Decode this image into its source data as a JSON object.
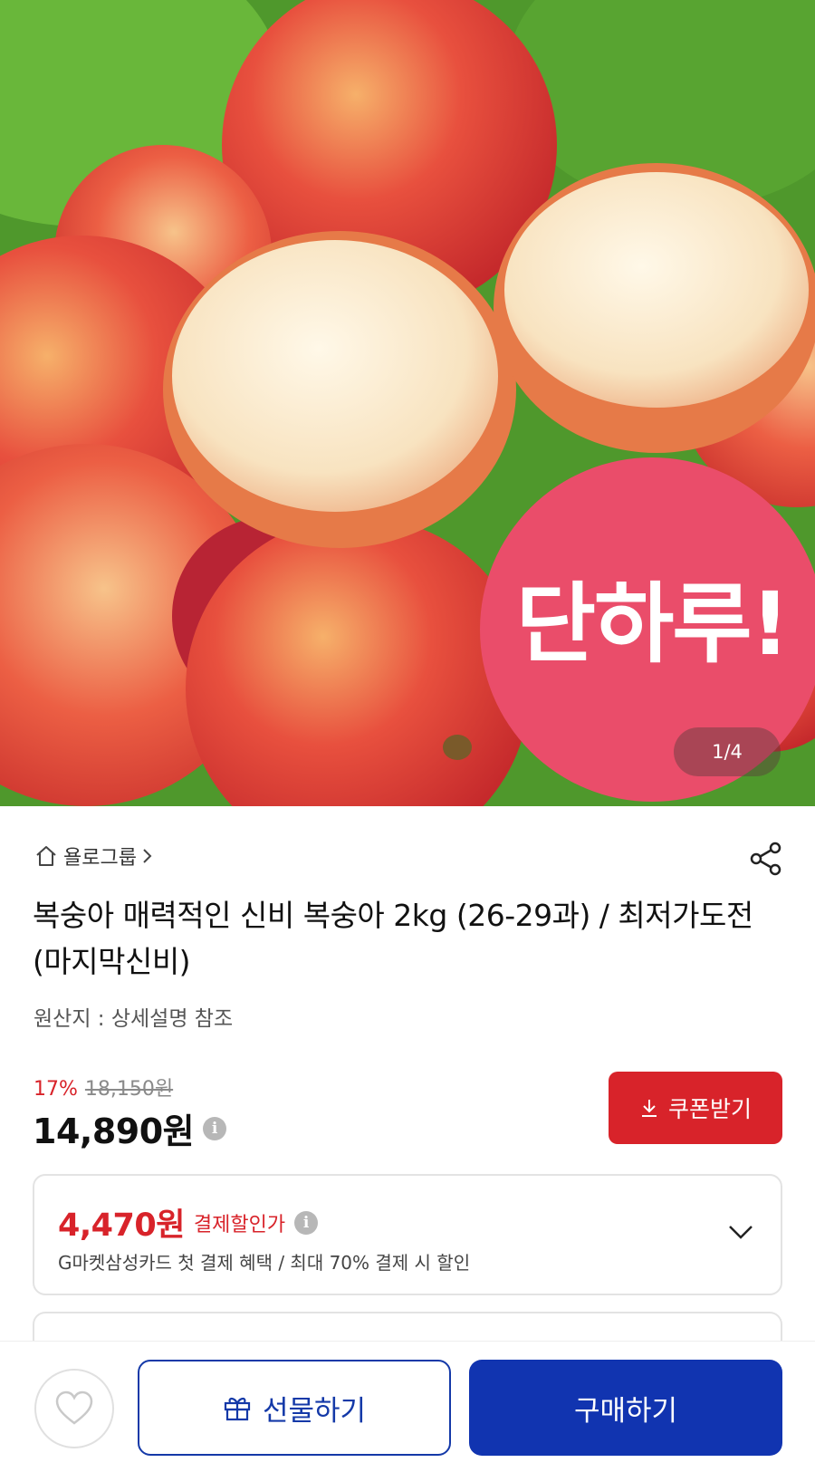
{
  "hero": {
    "badge_text": "단하루!",
    "image_counter": "1/4",
    "photo_alt": "peach-photo",
    "colors": {
      "badge": "#ea4d6a",
      "leaves": "#4e9a2a",
      "peach_red": "#e0453a",
      "peach_flesh": "#fbe9c6"
    }
  },
  "product": {
    "seller": "욜로그룹",
    "title": "복숭아 매력적인 신비 복숭아 2kg (26-29과) / 최저가도전 (마지막신비)",
    "origin": "원산지 : 상세설명 참조",
    "discount_rate": "17%",
    "original_price": "18,150원",
    "price": "14,890원",
    "coupon_label": "쿠폰받기"
  },
  "payment_offer": {
    "price": "4,470원",
    "label": "결제할인가",
    "description": "G마켓삼성카드 첫 결제 혜택 / 최대 70% 결제 시 할인"
  },
  "bottom_bar": {
    "gift_label": "선물하기",
    "buy_label": "구매하기"
  },
  "theme": {
    "accent_red": "#d8232a",
    "brand_blue": "#1134b0"
  }
}
